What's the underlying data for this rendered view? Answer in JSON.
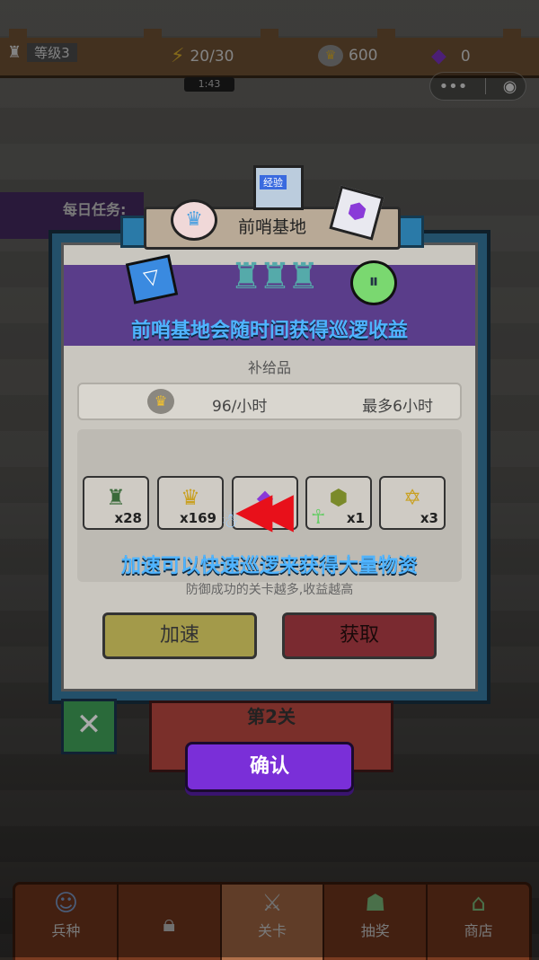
{
  "hud": {
    "level": "等级3",
    "energy": "20/30",
    "coins": "600",
    "gems": "0",
    "timer": "1:43"
  },
  "daily_task": {
    "label": "每日任务:"
  },
  "modal": {
    "title": "前哨基地",
    "badge_label": "经验",
    "headline": "前哨基地会随时间获得巡逻收益",
    "supply_label": "补给品",
    "rate": "96/小时",
    "max": "最多6小时",
    "rewards": [
      {
        "icon": "tower-chest-icon",
        "qty": "x28"
      },
      {
        "icon": "crown-coin-icon",
        "qty": "x169"
      },
      {
        "icon": "purple-gem-icon",
        "qty": ""
      },
      {
        "icon": "hex-gem-icon",
        "qty": "x1"
      },
      {
        "icon": "star-badge-icon",
        "qty": "x3"
      }
    ],
    "tip_main": "加速可以快速巡逻来获得大量物资",
    "tip_sub": "防御成功的关卡越多,收益越高",
    "speed_button": "加速",
    "claim_button": "获取"
  },
  "stage": {
    "label": "第2关"
  },
  "confirm_button": "确认",
  "nav": [
    {
      "label": "兵种",
      "icon": "soldier-icon"
    },
    {
      "label": "",
      "icon": "lock-icon"
    },
    {
      "label": "关卡",
      "icon": "crossed-swords-icon"
    },
    {
      "label": "抽奖",
      "icon": "lottery-icon"
    },
    {
      "label": "商店",
      "icon": "shop-icon"
    }
  ],
  "colors": {
    "headline_blue": "#4fb4ff",
    "confirm_purple": "#7a2fd8",
    "header_purple": "#5a3d8a"
  }
}
